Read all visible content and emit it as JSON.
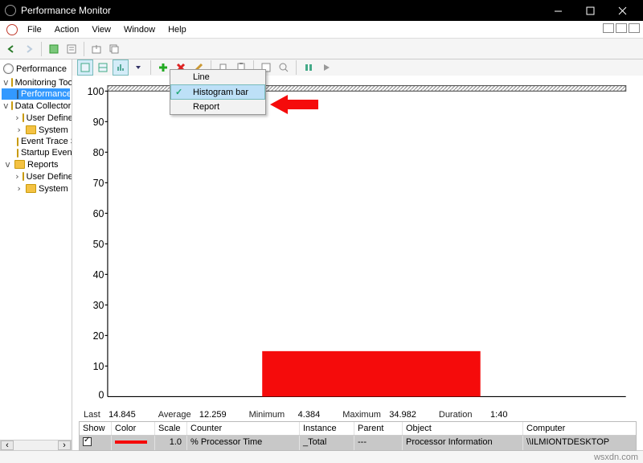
{
  "window": {
    "title": "Performance Monitor"
  },
  "menu": {
    "file": "File",
    "action": "Action",
    "view": "View",
    "window": "Window",
    "help": "Help"
  },
  "tree": {
    "root": "Performance",
    "monitoring_tools": "Monitoring Tools",
    "performance_monitor": "Performance Monitor",
    "data_collector_sets": "Data Collector Sets",
    "user_defined": "User Defined",
    "system": "System",
    "event_trace": "Event Trace Sessions",
    "startup_event_trace": "Startup Event Trace Sessions",
    "reports": "Reports",
    "user_defined2": "User Defined",
    "system2": "System"
  },
  "dropdown": {
    "line": "Line",
    "histogram": "Histogram bar",
    "report": "Report"
  },
  "stats": {
    "last_label": "Last",
    "last_val": "14.845",
    "avg_label": "Average",
    "avg_val": "12.259",
    "min_label": "Minimum",
    "min_val": "4.384",
    "max_label": "Maximum",
    "max_val": "34.982",
    "dur_label": "Duration",
    "dur_val": "1:40"
  },
  "table": {
    "h_show": "Show",
    "h_color": "Color",
    "h_scale": "Scale",
    "h_counter": "Counter",
    "h_instance": "Instance",
    "h_parent": "Parent",
    "h_object": "Object",
    "h_computer": "Computer",
    "r_scale": "1.0",
    "r_counter": "% Processor Time",
    "r_instance": "_Total",
    "r_parent": "---",
    "r_object": "Processor Information",
    "r_computer": "\\\\ILMIONTDESKTOP"
  },
  "chart_data": {
    "type": "bar",
    "title": "",
    "categories": [
      "% Processor Time"
    ],
    "values": [
      15
    ],
    "ylabel": "",
    "xlabel": "",
    "ylim": [
      0,
      100
    ],
    "yticks": [
      0,
      10,
      20,
      30,
      40,
      50,
      60,
      70,
      80,
      90,
      100
    ],
    "color": "#f50b0b"
  },
  "footer": {
    "credit": "wsxdn.com"
  }
}
